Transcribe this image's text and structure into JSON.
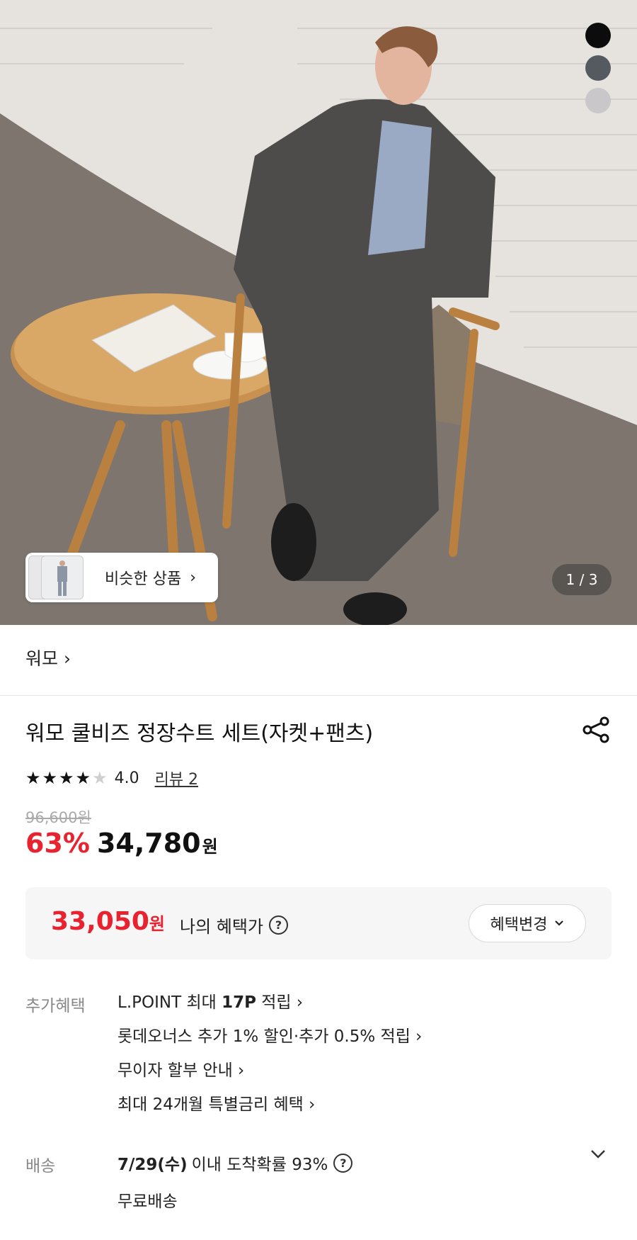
{
  "hero": {
    "swatch_colors": [
      "#0c0c0c",
      "#555a60",
      "#c9c7c9"
    ],
    "similar_label": "비슷한 상품",
    "similar_chevron": "›",
    "counter": "1 / 3"
  },
  "brand": {
    "name": "워모",
    "chevron": "›"
  },
  "product": {
    "title": "워모 쿨비즈 정장수트 세트(자켓+팬츠)",
    "rating_value": 4.0,
    "rating_text": "4.0",
    "reviews": "리뷰 2",
    "original_price": "96,600원",
    "discount": "63%",
    "price": "34,780",
    "currency": "원"
  },
  "benefit": {
    "price": "33,050",
    "currency": "원",
    "label": "나의 혜택가",
    "help": "?",
    "change_button": "혜택변경",
    "change_icon": "chevron-down-icon"
  },
  "extra": {
    "label": "추가혜택",
    "items": [
      {
        "pre": "L.POINT 최대 ",
        "bold": "17P",
        "post": " 적립 ›"
      },
      {
        "pre": "롯데오너스 추가 1% 할인·추가 0.5% 적립 ›",
        "bold": "",
        "post": ""
      },
      {
        "pre": "무이자 할부 안내 ›",
        "bold": "",
        "post": ""
      },
      {
        "pre": "최대 24개월 특별금리 혜택 ›",
        "bold": "",
        "post": ""
      }
    ]
  },
  "shipping": {
    "label": "배송",
    "date": "7/29(수)",
    "text": "이내 도착확률 93%",
    "help": "?",
    "fee": "무료배송",
    "chevron": "⌄"
  },
  "colors": {
    "accent": "#e8222e"
  }
}
